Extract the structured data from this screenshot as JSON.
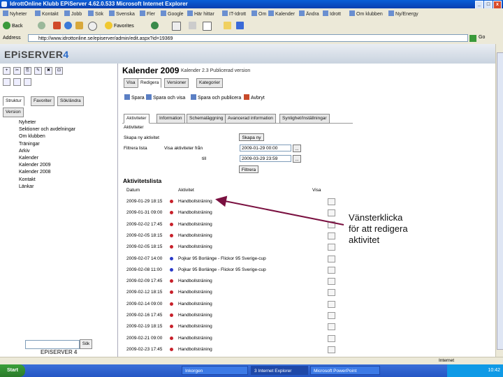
{
  "window": {
    "title": "IdrottOnline Klubb  EPiServer 4.62.0.533  Microsoft Internet Explorer",
    "btn_min": "_",
    "btn_max": "□",
    "btn_close": "x"
  },
  "links": [
    "Nyheter",
    "Kontakt",
    "Jobb",
    "Sök",
    "Svenska",
    "Fler",
    "Google",
    "Här hittar",
    "IT-Idrott",
    "Om",
    "Kalender",
    "Ändra",
    "Idrott",
    "Om klubben",
    "Ny/Energy"
  ],
  "nav": {
    "back": "Back",
    "favorites": "Favorites"
  },
  "address": {
    "label": "Address",
    "value": "http://www.idrottonline.se/episerver/admin/edit.aspx?id=19369",
    "go": "Go"
  },
  "epi": {
    "logo_a": "EPiSERVER",
    "logo_b": "4"
  },
  "left": {
    "icons": [
      "+",
      "✂",
      "⎘",
      "✎",
      "✖",
      "⊡"
    ],
    "tabs": [
      "Struktur",
      "Favoriter",
      "Sök/ändra",
      "Version"
    ],
    "tree": [
      "Nyheter",
      "Sektioner och avdelningar",
      "Om klubben",
      "Träningar",
      "Arkiv",
      "Kalender",
      "Kalender 2009",
      "Kalender 2008",
      "Kontakt",
      "Länkar"
    ],
    "search_btn": "Sök",
    "logo": "EPiSERVER 4"
  },
  "main": {
    "title": "Kalender 2009",
    "subtitle": "Kalender 2.3  Publicerad version",
    "tabs": [
      "Visa",
      "Redigera",
      "Versioner",
      "Kategorier"
    ],
    "toolbar": [
      "Spara",
      "Spara och visa",
      "Spara och publicera",
      "Avbryt"
    ],
    "subtabs": [
      "Aktiviteter",
      "Information",
      "Schemaläggning",
      "Avancerad information",
      "Synlighet/Inställningar"
    ],
    "section_label": "Aktiviteter",
    "form": {
      "new_label": "Skapa ny aktivitet",
      "new_btn": "Skapa ny",
      "filter_label": "Filtrera lista",
      "from_label": "Visa aktiviteter från",
      "from_value": "2009-01-29 00:00",
      "to_label": "till",
      "to_value": "2009-03-29 23:59",
      "filter_btn": "Filtrera",
      "browse": "..."
    },
    "list_title": "Aktivitetslista",
    "columns": {
      "date": "Datum",
      "activity": "Aktivitet",
      "view": "Visa"
    },
    "rows": [
      {
        "date": "2009-01-29 18:15",
        "activity": "Handbollsträning",
        "color": "#c8202a"
      },
      {
        "date": "2009-01-31 09:00",
        "activity": "Handbollsträning",
        "color": "#c8202a"
      },
      {
        "date": "2009-02-02 17:45",
        "activity": "Handbollsträning",
        "color": "#c8202a"
      },
      {
        "date": "2009-02-05 18:15",
        "activity": "Handbollsträning",
        "color": "#c8202a"
      },
      {
        "date": "2009-02-05 18:15",
        "activity": "Handbollsträning",
        "color": "#c8202a"
      },
      {
        "date": "2009-02-07 14:00",
        "activity": "Pojkar 95 Borlänge - Flickor 95 Sverige-cup",
        "color": "#2a3ac8"
      },
      {
        "date": "2009-02-08 11:00",
        "activity": "Pojkar 95 Borlänge - Flickor 95 Sverige-cup",
        "color": "#2a3ac8"
      },
      {
        "date": "2009-02-09 17:45",
        "activity": "Handbollsträning",
        "color": "#c8202a"
      },
      {
        "date": "2009-02-12 18:15",
        "activity": "Handbollsträning",
        "color": "#c8202a"
      },
      {
        "date": "2009-02-14 09:00",
        "activity": "Handbollsträning",
        "color": "#c8202a"
      },
      {
        "date": "2009-02-16 17:45",
        "activity": "Handbollsträning",
        "color": "#c8202a"
      },
      {
        "date": "2009-02-19 18:15",
        "activity": "Handbollsträning",
        "color": "#c8202a"
      },
      {
        "date": "2009-02-21 09:00",
        "activity": "Handbollsträning",
        "color": "#c8202a"
      },
      {
        "date": "2009-02-23 17:45",
        "activity": "Handbollsträning",
        "color": "#c8202a"
      }
    ]
  },
  "callout": "Vänsterklicka\nför att redigera\naktivitet",
  "status": {
    "zone": "Internet"
  },
  "taskbar": {
    "start": "Start",
    "tasks": [
      "Inkorgen",
      "3 Internet Explorer",
      "Microsoft PowerPoint"
    ],
    "time": "10:42"
  },
  "colors": {
    "accent": "#2a6bc9",
    "arrow": "#7a1040"
  }
}
